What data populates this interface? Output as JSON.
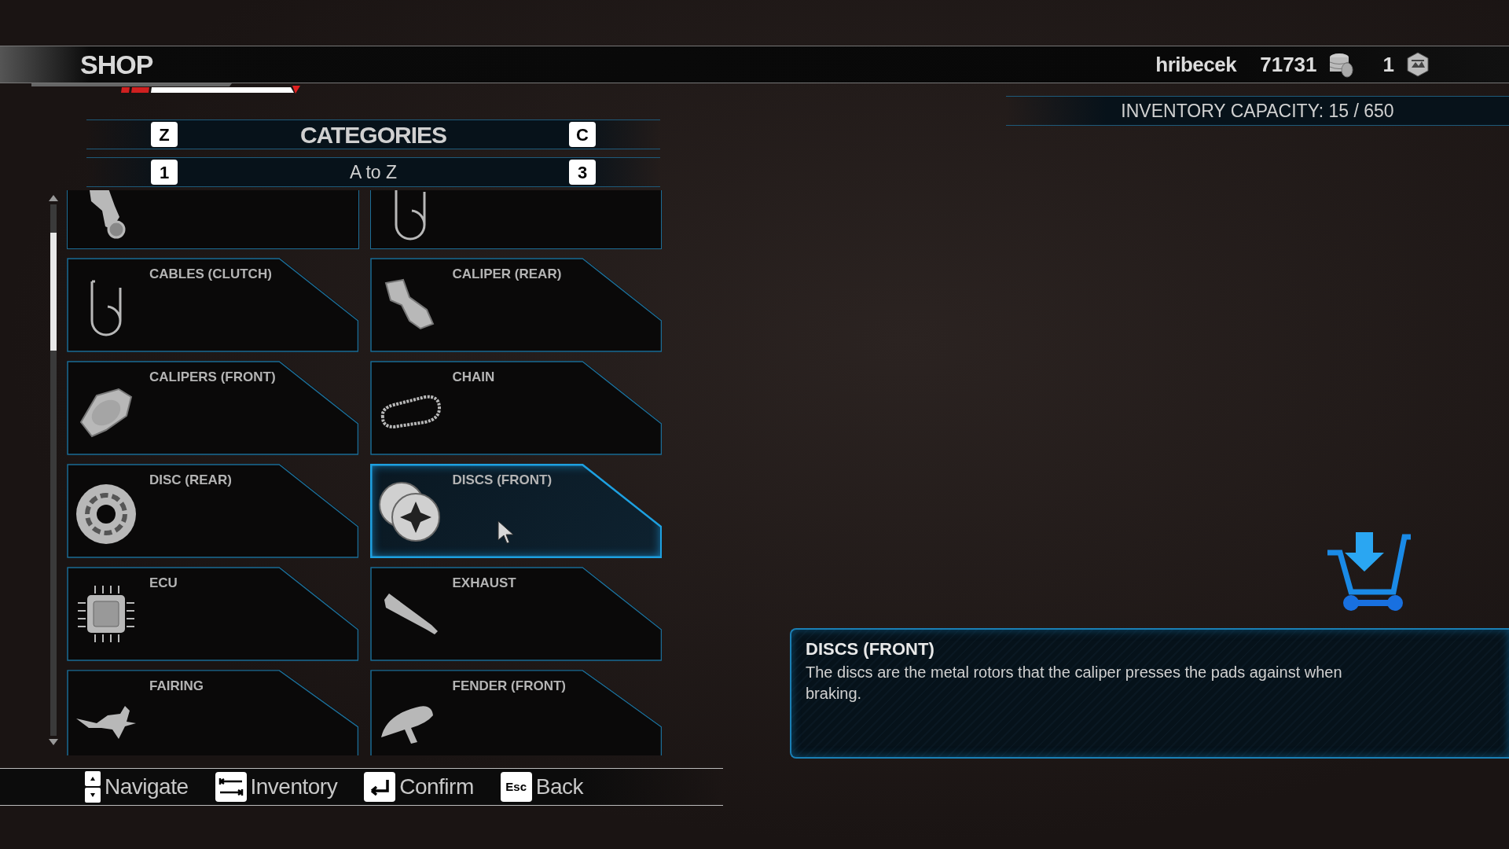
{
  "header": {
    "title": "SHOP",
    "username": "hribecek",
    "credits": "71731",
    "tokens": "1"
  },
  "inventory_capacity": "INVENTORY CAPACITY: 15 / 650",
  "categories": {
    "prev_key": "Z",
    "title": "CATEGORIES",
    "next_key": "C"
  },
  "sort": {
    "prev_key": "1",
    "label": "A to Z",
    "next_key": "3"
  },
  "items": [
    {
      "kind": "partial",
      "selected": false
    },
    {
      "kind": "partial",
      "selected": false
    },
    {
      "kind": "full",
      "label": "CABLES (CLUTCH)",
      "selected": false
    },
    {
      "kind": "full",
      "label": "CALIPER (REAR)",
      "selected": false
    },
    {
      "kind": "full",
      "label": "CALIPERS (FRONT)",
      "selected": false
    },
    {
      "kind": "full",
      "label": "CHAIN",
      "selected": false
    },
    {
      "kind": "full",
      "label": "DISC (REAR)",
      "selected": false
    },
    {
      "kind": "full",
      "label": "DISCS (FRONT)",
      "selected": true
    },
    {
      "kind": "full",
      "label": "ECU",
      "selected": false
    },
    {
      "kind": "full",
      "label": "EXHAUST",
      "selected": false
    },
    {
      "kind": "full",
      "label": "FAIRING",
      "selected": false
    },
    {
      "kind": "full",
      "label": "FENDER (FRONT)",
      "selected": false
    }
  ],
  "description": {
    "title": "DISCS (FRONT)",
    "text": "The discs are the metal rotors that the caliper presses the pads against when braking."
  },
  "controls": [
    {
      "kind": "arrows",
      "label": "Navigate"
    },
    {
      "kind": "tab",
      "label": "Inventory"
    },
    {
      "kind": "enter",
      "label": "Confirm"
    },
    {
      "kind": "key",
      "key": "Esc",
      "label": "Back"
    }
  ]
}
